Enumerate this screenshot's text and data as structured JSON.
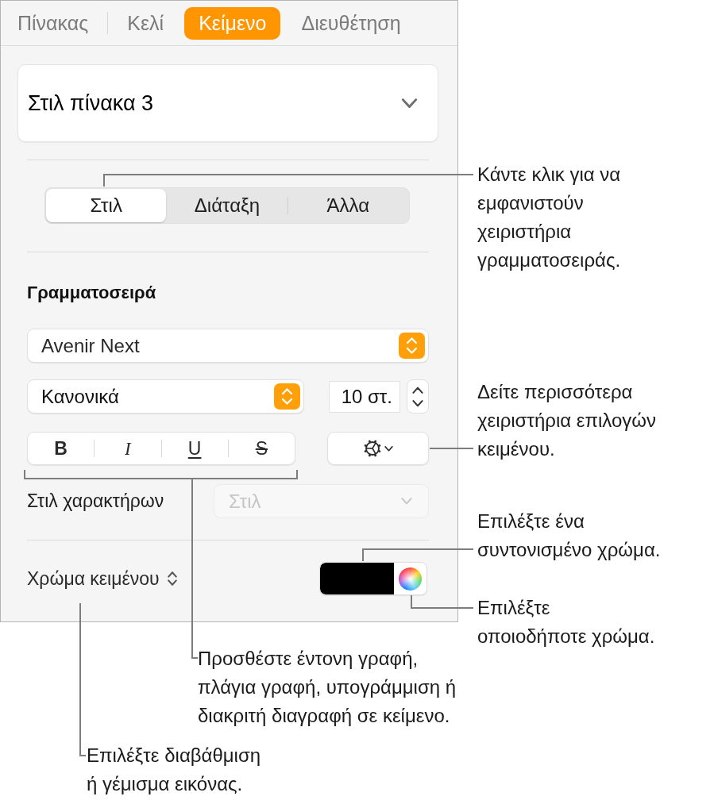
{
  "inspector_tabs": [
    {
      "label": "Πίνακας",
      "selected": false
    },
    {
      "label": "Κελί",
      "selected": false
    },
    {
      "label": "Κείμενο",
      "selected": true
    },
    {
      "label": "Διευθέτηση",
      "selected": false
    }
  ],
  "table_style": {
    "value": "Στιλ πίνακα 3"
  },
  "text_sections": [
    {
      "label": "Στιλ",
      "selected": true
    },
    {
      "label": "Διάταξη",
      "selected": false
    },
    {
      "label": "Άλλα",
      "selected": false
    }
  ],
  "font": {
    "heading": "Γραμματοσειρά",
    "family": "Avenir Next",
    "typeface": "Κανονικά",
    "size": "10 στ.",
    "format_buttons": [
      {
        "kind": "bold",
        "label": "B"
      },
      {
        "kind": "italic",
        "label": "I"
      },
      {
        "kind": "underline",
        "label": "U"
      },
      {
        "kind": "strikethrough",
        "label": "S"
      }
    ]
  },
  "character_style": {
    "label": "Στιλ χαρακτήρων",
    "value": "Στιλ",
    "disabled": true
  },
  "text_color": {
    "fill_type_label": "Χρώμα κειμένου",
    "color": "#000000"
  },
  "callouts": [
    {
      "lines": [
        "Κάντε κλικ για να",
        "εμφανιστούν",
        "χειριστήρια",
        "γραμματοσειράς."
      ]
    },
    {
      "lines": [
        "Δείτε περισσότερα",
        "χειριστήρια επιλογών",
        "κειμένου."
      ]
    },
    {
      "lines": [
        "Επιλέξτε ένα",
        "συντονισμένο χρώμα."
      ]
    },
    {
      "lines": [
        "Επιλέξτε",
        "οποιοδήποτε χρώμα."
      ]
    },
    {
      "lines": [
        "Προσθέστε έντονη γραφή,",
        "πλάγια γραφή, υπογράμμιση ή",
        "διακριτή διαγραφή σε κείμενο."
      ]
    },
    {
      "lines": [
        "Επιλέξτε διαβάθμιση",
        "ή γέμισμα εικόνας."
      ]
    }
  ]
}
